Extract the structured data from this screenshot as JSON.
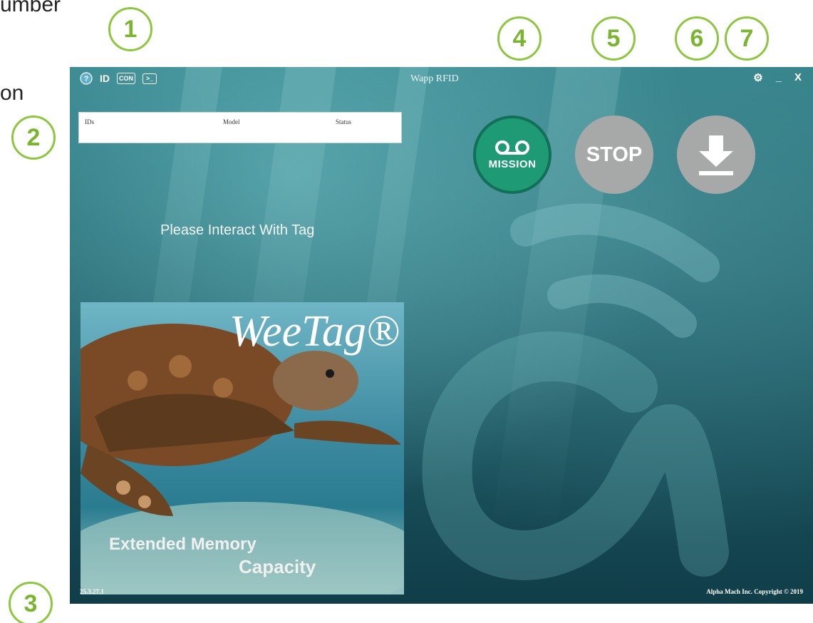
{
  "doc": {
    "top_text": "umber",
    "mid_text": "on"
  },
  "callouts": [
    "1",
    "2",
    "3",
    "4",
    "5",
    "6",
    "7"
  ],
  "window": {
    "title": "Wapp RFID",
    "toolbar": {
      "id_label": "ID",
      "con_label": "CON",
      "terminal_label": ">_"
    },
    "controls": {
      "settings_glyph": "⚙",
      "minimize_glyph": "_",
      "close_glyph": "X"
    }
  },
  "table": {
    "headers": [
      "IDs",
      "Model",
      "Status"
    ]
  },
  "buttons": {
    "mission_label": "MISSION",
    "stop_label": "STOP"
  },
  "prompt": "Please Interact With Tag",
  "promo": {
    "brand": "WeeTag®",
    "line1": "Extended Memory",
    "line2": "Capacity"
  },
  "footer": {
    "version": "25.3.27.1",
    "copyright": "Alpha Mach Inc. Copyright © 2019"
  },
  "colors": {
    "callout": "#8dc63f",
    "mission": "#1e9a74",
    "stop": "#a7a9a9",
    "background": "#2f7d86"
  }
}
